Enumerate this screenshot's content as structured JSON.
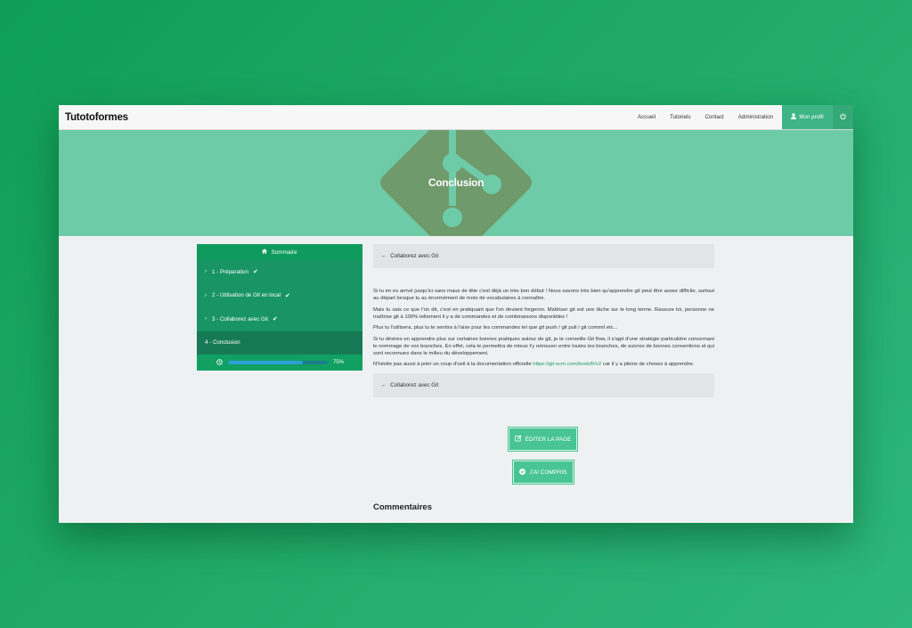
{
  "navbar": {
    "brand": "Tutotoformes",
    "links": [
      "Accueil",
      "Tutoriels",
      "Contact",
      "Administration"
    ],
    "profile_label": "Mon profil",
    "profile_icon": "user-icon",
    "power_icon": "power-icon"
  },
  "hero": {
    "title": "Conclusion",
    "background_icon": "git-logo"
  },
  "sidebar": {
    "header": "Sommaire",
    "header_icon": "home-icon",
    "items": [
      {
        "label": "1 - Préparation",
        "done": true
      },
      {
        "label": "2 - Utilisation de Git en local",
        "done": true
      },
      {
        "label": "3 - Collaborez avec Git",
        "done": true
      },
      {
        "label": "4 - Conclusion",
        "done": false,
        "active": true
      }
    ],
    "progress": {
      "value": 0.75,
      "label": "75%"
    }
  },
  "main": {
    "prev_label_top": "Collaborez avec Git",
    "prev_label_bottom": "Collaborez avec Git",
    "paragraphs": [
      "Si tu en es arrivé jusqu'ici sans maux de tête c'est déjà un très bon début ! Nous savons très bien qu'apprendre git peut être assez difficile, surtout au départ lorsque tu as énormément de mots de vocabulaires à connaître.",
      "Mais tu sais ce que l'on dit, c'est en pratiquant que l'on devient forgeron. Maîtriser git est une tâche sur le long terme. Rassure toi, personne ne maîtrise git à 100% tellement il y a de commandes et de combinaisons disponibles !",
      "Plus tu l'utilisera, plus tu te sentira à l'aise pour les commandes tel que git push / git pull / git commit etc...",
      "Si tu désires en apprendre plus sur certaines bonnes pratiques autour de git, je te conseille Git flow, il s'agit d'une stratégie particulière concernant le nommage de vos branches. En effet, cela te permettra de mieux t'y retrouver entre toutes tes branches, de suivres de bonnes conventions et qui sont reconnues dans le milieu du développement."
    ],
    "last_paragraph": {
      "before": "N'hésite pas aussi à jeter un coup d'oeil à la documentation officielle ",
      "link": "https://git-scm.com/book/fr/v2",
      "after": " car il y a pleins de choses à apprendre."
    },
    "edit_button": "ÉDITER LA PAGE",
    "understood_button": "J'AI COMPRIS",
    "comments_title": "Commentaires"
  },
  "colors": {
    "background": "#18a562",
    "accent": "#48c592",
    "sidebar": "#199465",
    "hero": "#6ecba7"
  }
}
